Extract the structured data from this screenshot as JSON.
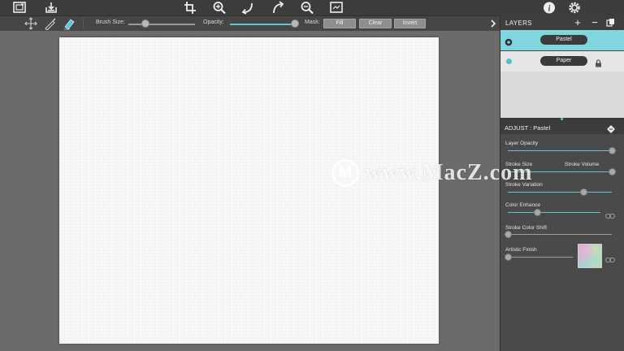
{
  "toolbar": {
    "icons": [
      "new-canvas-icon",
      "save-icon",
      "crop-icon",
      "zoom-in-icon",
      "undo-icon",
      "redo-icon",
      "zoom-out-icon",
      "fit-screen-icon",
      "info-icon",
      "settings-icon"
    ]
  },
  "brush_bar": {
    "brush_size_label": "Brush Size:",
    "brush_size_value": 0.26,
    "opacity_label": "Opacity:",
    "opacity_value": 1.0,
    "mask_label": "Mask:",
    "fill_label": "Fill",
    "clear_label": "Clear",
    "invert_label": "Invert"
  },
  "layers": {
    "title": "LAYERS",
    "items": [
      {
        "name": "Pastel",
        "active": true
      },
      {
        "name": "Paper",
        "active": false,
        "locked": true
      }
    ]
  },
  "adjust": {
    "title": "ADJUST : Pastel",
    "sliders": [
      {
        "label": "Layer Opacity",
        "value": 1.0
      },
      {
        "label": "Stroke Size",
        "value": 0.0
      },
      {
        "label": "Stroke Volume",
        "value": 1.0
      },
      {
        "label": "Stroke Variation",
        "value": 0.73
      },
      {
        "label": "Color Enhance",
        "value": 0.32
      },
      {
        "label": "Stroke Color Shift",
        "value": 0.0
      },
      {
        "label": "Artistic Finish",
        "value": 0.0
      }
    ]
  },
  "watermark": {
    "logo_letter": "M",
    "text": "www.MacZ.com"
  },
  "colors": {
    "accent": "#5fc6cf",
    "active_layer": "#7fd6df",
    "toolbar": "#3c3c3c",
    "workspace": "#6b6b6b",
    "canvas": "#f7f7f7"
  }
}
